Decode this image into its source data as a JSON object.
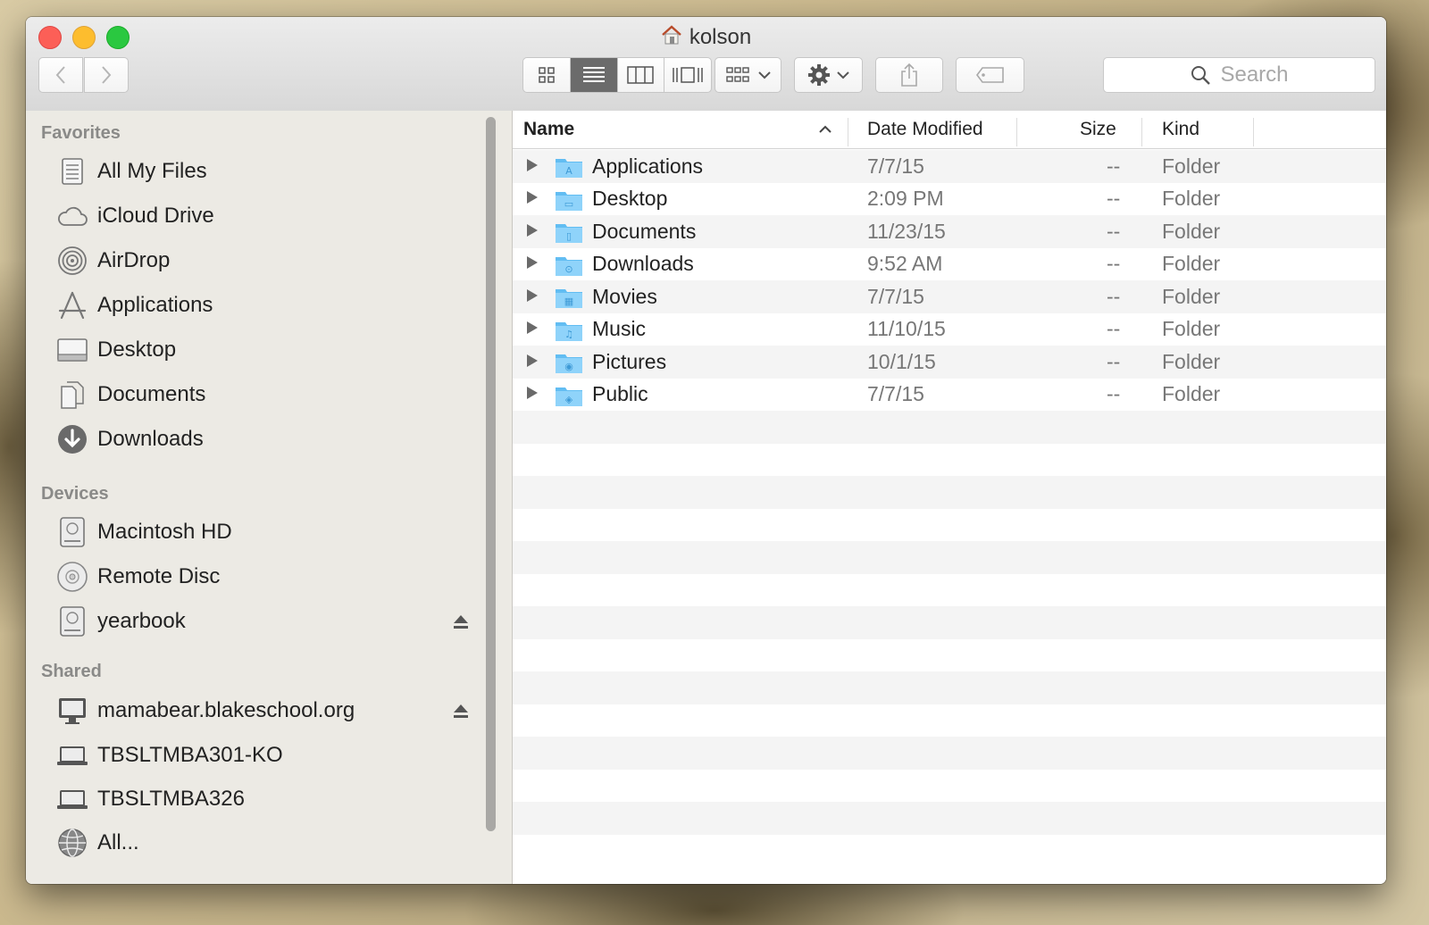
{
  "window": {
    "title": "kolson"
  },
  "toolbar": {
    "search_placeholder": "Search"
  },
  "sidebar": {
    "favorites_title": "Favorites",
    "favorites": [
      {
        "label": "All My Files",
        "icon": "all-files-icon"
      },
      {
        "label": "iCloud Drive",
        "icon": "cloud-icon"
      },
      {
        "label": "AirDrop",
        "icon": "airdrop-icon"
      },
      {
        "label": "Applications",
        "icon": "applications-icon"
      },
      {
        "label": "Desktop",
        "icon": "desktop-icon"
      },
      {
        "label": "Documents",
        "icon": "documents-icon"
      },
      {
        "label": "Downloads",
        "icon": "downloads-icon"
      }
    ],
    "devices_title": "Devices",
    "devices": [
      {
        "label": "Macintosh HD",
        "icon": "hard-drive-icon"
      },
      {
        "label": "Remote Disc",
        "icon": "disc-icon"
      },
      {
        "label": "yearbook",
        "icon": "hard-drive-icon"
      }
    ],
    "shared_title": "Shared",
    "shared": [
      {
        "label": "mamabear.blakeschool.org",
        "icon": "monitor-icon"
      },
      {
        "label": "TBSLTMBA301-KO",
        "icon": "laptop-icon"
      },
      {
        "label": "TBSLTMBA326",
        "icon": "laptop-icon"
      },
      {
        "label": "All...",
        "icon": "network-globe-icon"
      }
    ]
  },
  "columns": {
    "name": "Name",
    "date": "Date Modified",
    "size": "Size",
    "kind": "Kind"
  },
  "files": [
    {
      "name": "Applications",
      "date": "7/7/15",
      "size": "--",
      "kind": "Folder"
    },
    {
      "name": "Desktop",
      "date": "2:09 PM",
      "size": "--",
      "kind": "Folder"
    },
    {
      "name": "Documents",
      "date": "11/23/15",
      "size": "--",
      "kind": "Folder"
    },
    {
      "name": "Downloads",
      "date": "9:52 AM",
      "size": "--",
      "kind": "Folder"
    },
    {
      "name": "Movies",
      "date": "7/7/15",
      "size": "--",
      "kind": "Folder"
    },
    {
      "name": "Music",
      "date": "11/10/15",
      "size": "--",
      "kind": "Folder"
    },
    {
      "name": "Pictures",
      "date": "10/1/15",
      "size": "--",
      "kind": "Folder"
    },
    {
      "name": "Public",
      "date": "7/7/15",
      "size": "--",
      "kind": "Folder"
    }
  ],
  "colors": {
    "folder_blue": "#62bdf2",
    "close": "#fc5f57",
    "minimize": "#fdbd2e",
    "maximize": "#2ac840"
  }
}
